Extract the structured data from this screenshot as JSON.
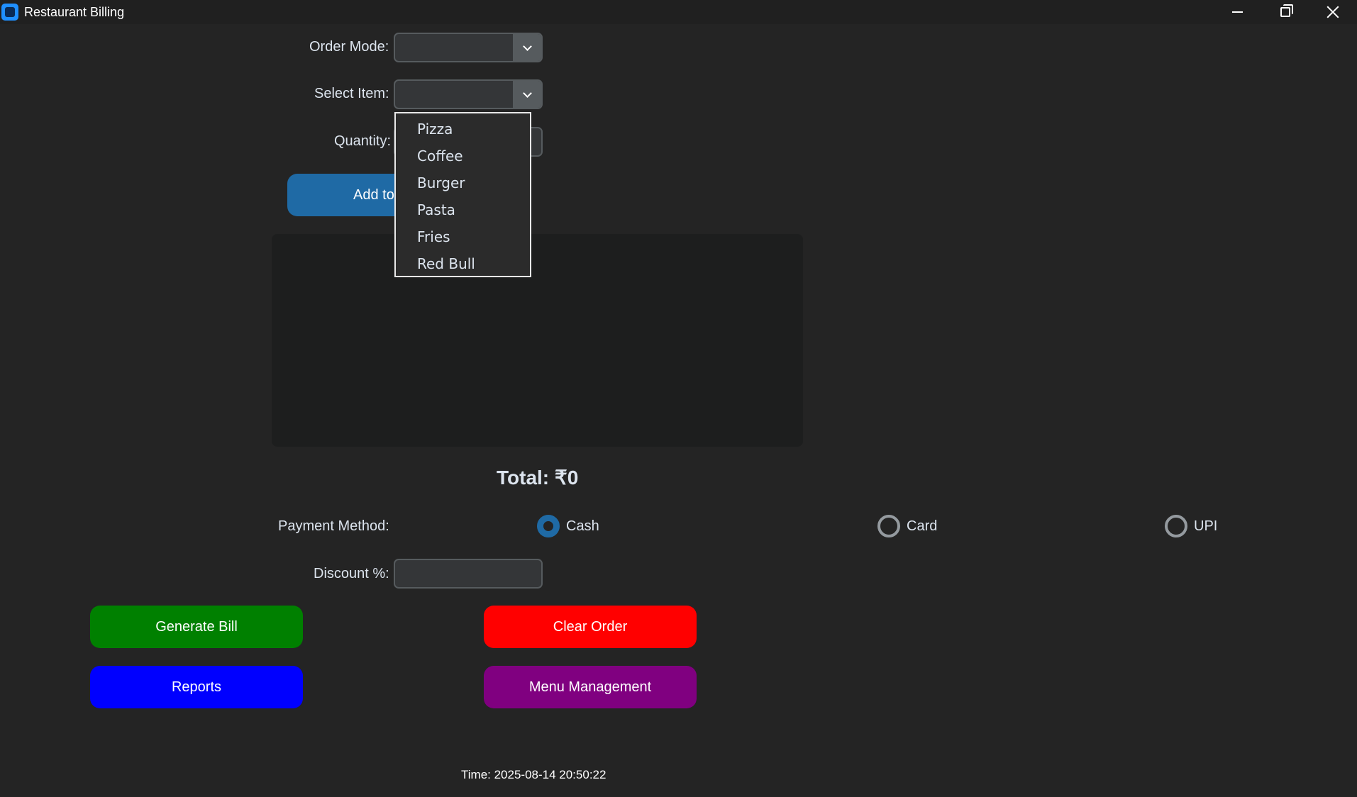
{
  "window": {
    "title": "Restaurant Billing"
  },
  "form": {
    "order_mode_label": "Order Mode:",
    "order_mode_value": "",
    "select_item_label": "Select Item:",
    "select_item_value": "",
    "quantity_label": "Quantity:",
    "quantity_value": "",
    "add_button_label": "Add to"
  },
  "item_dropdown": {
    "options": [
      "Pizza",
      "Coffee",
      "Burger",
      "Pasta",
      "Fries",
      "Red Bull"
    ]
  },
  "order_box": {
    "content": ""
  },
  "total": {
    "text": "Total: ₹0"
  },
  "payment": {
    "label": "Payment Method:",
    "selected": "Cash",
    "options": [
      {
        "label": "Cash",
        "selected": true
      },
      {
        "label": "Card",
        "selected": false
      },
      {
        "label": "UPI",
        "selected": false
      }
    ]
  },
  "discount": {
    "label": "Discount %:",
    "value": ""
  },
  "buttons": {
    "generate_bill": "Generate Bill",
    "clear_order": "Clear Order",
    "reports": "Reports",
    "menu_management": "Menu Management"
  },
  "colors": {
    "generate_bill": "#008000",
    "clear_order": "#ff0000",
    "reports": "#0000ff",
    "menu_management": "#800080",
    "accent": "#1f6aa5"
  },
  "status": {
    "time_text": "Time: 2025-08-14 20:50:22"
  }
}
